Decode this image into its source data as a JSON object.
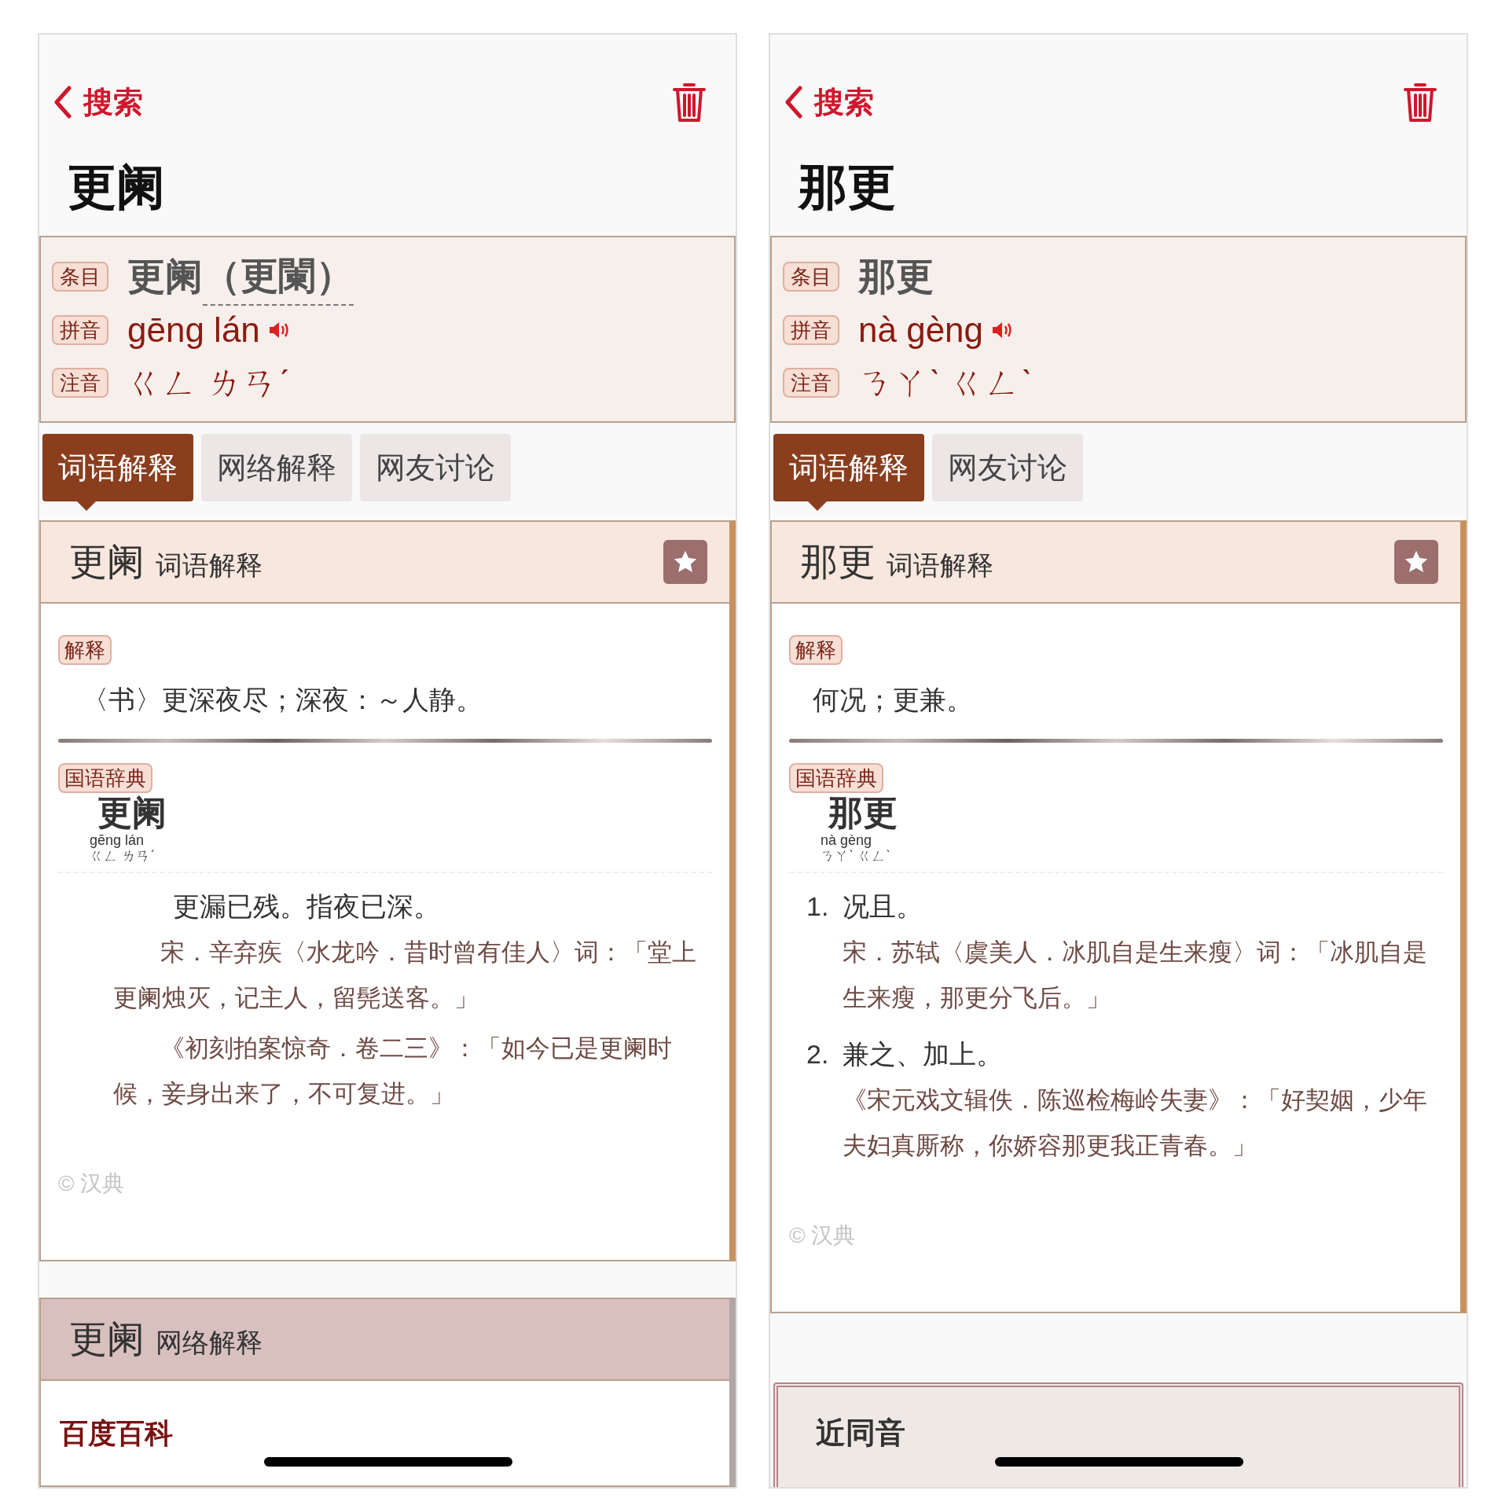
{
  "panels": [
    {
      "nav": {
        "back_label": "搜索"
      },
      "title": "更阑",
      "entry": [
        {
          "kind": "word",
          "tag": "条目",
          "text": "更阑",
          "variant": "（更闌）"
        },
        {
          "kind": "pinyin",
          "tag": "拼音",
          "text": "gēng lán"
        },
        {
          "kind": "zhuyin",
          "tag": "注音",
          "text": "ㄍㄥ ㄌㄢˊ"
        }
      ],
      "tabs": [
        {
          "label": "词语解释",
          "selected": true
        },
        {
          "label": "网络解释",
          "selected": false
        },
        {
          "label": "网友讨论",
          "selected": false
        }
      ],
      "sections": [
        {
          "kind": "main",
          "word": "更阑",
          "label": "词语解释",
          "blocks": [
            {
              "kind": "tag",
              "text": "解释"
            },
            {
              "kind": "definition",
              "text": "〈书〉更深夜尽；深夜：～人静。"
            },
            {
              "kind": "divider"
            },
            {
              "kind": "tag",
              "text": "国语辞典"
            },
            {
              "kind": "headword",
              "word": "更阑",
              "pinyin": "gēng lán",
              "zhuyin": "ㄍㄥ ㄌㄢˊ"
            },
            {
              "kind": "sense",
              "text": "更漏已残。指夜已深。",
              "examples": [
                "宋．辛弃疾〈水龙吟．昔时曾有佳人〉词：「堂上更阑烛灭，记主人，留髡送客。」",
                "《初刻拍案惊奇．卷二三》：「如今已是更阑时候，妾身出来了，不可复进。」"
              ]
            }
          ],
          "copyright": "© 汉典"
        },
        {
          "kind": "web",
          "word": "更阑",
          "label": "网络解释",
          "source": "百度百科"
        }
      ]
    },
    {
      "nav": {
        "back_label": "搜索"
      },
      "title": "那更",
      "entry": [
        {
          "kind": "word",
          "tag": "条目",
          "text": "那更"
        },
        {
          "kind": "pinyin",
          "tag": "拼音",
          "text": "nà gèng"
        },
        {
          "kind": "zhuyin",
          "tag": "注音",
          "text": "ㄋㄚˋ ㄍㄥˋ"
        }
      ],
      "tabs": [
        {
          "label": "词语解释",
          "selected": true
        },
        {
          "label": "网友讨论",
          "selected": false
        }
      ],
      "sections": [
        {
          "kind": "main",
          "word": "那更",
          "label": "词语解释",
          "blocks": [
            {
              "kind": "tag",
              "text": "解释"
            },
            {
              "kind": "definition",
              "text": "何况；更兼。"
            },
            {
              "kind": "divider"
            },
            {
              "kind": "tag",
              "text": "国语辞典"
            },
            {
              "kind": "headword",
              "word": "那更",
              "pinyin": "nà gèng",
              "zhuyin": "ㄋㄚˋ ㄍㄥˋ"
            },
            {
              "kind": "sense",
              "number": "1.",
              "text": "况且。",
              "examples": [
                "宋．苏轼〈虞美人．冰肌自是生来瘦〉词：「冰肌自是生来瘦，那更分飞后。」"
              ]
            },
            {
              "kind": "sense",
              "number": "2.",
              "text": "兼之、加上。",
              "examples": [
                "《宋元戏文辑佚．陈巡检梅岭失妻》：「好契姻，少年夫妇真厮称，你娇容那更我正青春。」"
              ]
            }
          ],
          "copyright": "© 汉典"
        },
        {
          "kind": "frame",
          "title": "近同音"
        }
      ]
    }
  ]
}
